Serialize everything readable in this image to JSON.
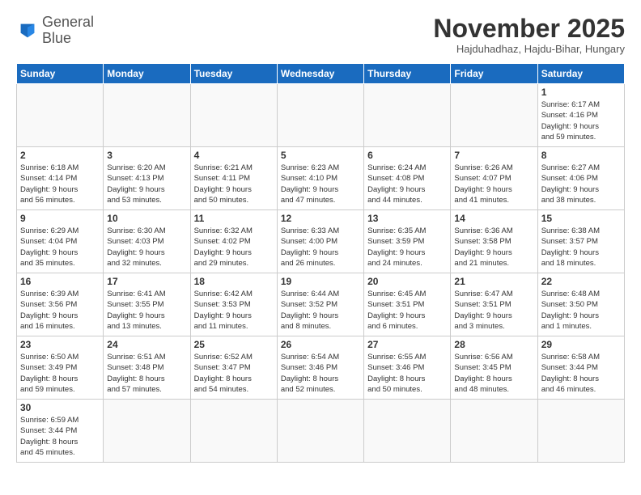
{
  "header": {
    "logo_line1": "General",
    "logo_line2": "Blue",
    "month": "November 2025",
    "location": "Hajduhadhaz, Hajdu-Bihar, Hungary"
  },
  "weekdays": [
    "Sunday",
    "Monday",
    "Tuesday",
    "Wednesday",
    "Thursday",
    "Friday",
    "Saturday"
  ],
  "days": {
    "1": {
      "sunrise": "6:17 AM",
      "sunset": "4:16 PM",
      "daylight_h": "9",
      "daylight_m": "59"
    },
    "2": {
      "sunrise": "6:18 AM",
      "sunset": "4:14 PM",
      "daylight_h": "9",
      "daylight_m": "56"
    },
    "3": {
      "sunrise": "6:20 AM",
      "sunset": "4:13 PM",
      "daylight_h": "9",
      "daylight_m": "53"
    },
    "4": {
      "sunrise": "6:21 AM",
      "sunset": "4:11 PM",
      "daylight_h": "9",
      "daylight_m": "50"
    },
    "5": {
      "sunrise": "6:23 AM",
      "sunset": "4:10 PM",
      "daylight_h": "9",
      "daylight_m": "47"
    },
    "6": {
      "sunrise": "6:24 AM",
      "sunset": "4:08 PM",
      "daylight_h": "9",
      "daylight_m": "44"
    },
    "7": {
      "sunrise": "6:26 AM",
      "sunset": "4:07 PM",
      "daylight_h": "9",
      "daylight_m": "41"
    },
    "8": {
      "sunrise": "6:27 AM",
      "sunset": "4:06 PM",
      "daylight_h": "9",
      "daylight_m": "38"
    },
    "9": {
      "sunrise": "6:29 AM",
      "sunset": "4:04 PM",
      "daylight_h": "9",
      "daylight_m": "35"
    },
    "10": {
      "sunrise": "6:30 AM",
      "sunset": "4:03 PM",
      "daylight_h": "9",
      "daylight_m": "32"
    },
    "11": {
      "sunrise": "6:32 AM",
      "sunset": "4:02 PM",
      "daylight_h": "9",
      "daylight_m": "29"
    },
    "12": {
      "sunrise": "6:33 AM",
      "sunset": "4:00 PM",
      "daylight_h": "9",
      "daylight_m": "26"
    },
    "13": {
      "sunrise": "6:35 AM",
      "sunset": "3:59 PM",
      "daylight_h": "9",
      "daylight_m": "24"
    },
    "14": {
      "sunrise": "6:36 AM",
      "sunset": "3:58 PM",
      "daylight_h": "9",
      "daylight_m": "21"
    },
    "15": {
      "sunrise": "6:38 AM",
      "sunset": "3:57 PM",
      "daylight_h": "9",
      "daylight_m": "18"
    },
    "16": {
      "sunrise": "6:39 AM",
      "sunset": "3:56 PM",
      "daylight_h": "9",
      "daylight_m": "16"
    },
    "17": {
      "sunrise": "6:41 AM",
      "sunset": "3:55 PM",
      "daylight_h": "9",
      "daylight_m": "13"
    },
    "18": {
      "sunrise": "6:42 AM",
      "sunset": "3:53 PM",
      "daylight_h": "9",
      "daylight_m": "11"
    },
    "19": {
      "sunrise": "6:44 AM",
      "sunset": "3:52 PM",
      "daylight_h": "9",
      "daylight_m": "8"
    },
    "20": {
      "sunrise": "6:45 AM",
      "sunset": "3:51 PM",
      "daylight_h": "9",
      "daylight_m": "6"
    },
    "21": {
      "sunrise": "6:47 AM",
      "sunset": "3:51 PM",
      "daylight_h": "9",
      "daylight_m": "3"
    },
    "22": {
      "sunrise": "6:48 AM",
      "sunset": "3:50 PM",
      "daylight_h": "9",
      "daylight_m": "1"
    },
    "23": {
      "sunrise": "6:50 AM",
      "sunset": "3:49 PM",
      "daylight_h": "8",
      "daylight_m": "59"
    },
    "24": {
      "sunrise": "6:51 AM",
      "sunset": "3:48 PM",
      "daylight_h": "8",
      "daylight_m": "57"
    },
    "25": {
      "sunrise": "6:52 AM",
      "sunset": "3:47 PM",
      "daylight_h": "8",
      "daylight_m": "54"
    },
    "26": {
      "sunrise": "6:54 AM",
      "sunset": "3:46 PM",
      "daylight_h": "8",
      "daylight_m": "52"
    },
    "27": {
      "sunrise": "6:55 AM",
      "sunset": "3:46 PM",
      "daylight_h": "8",
      "daylight_m": "50"
    },
    "28": {
      "sunrise": "6:56 AM",
      "sunset": "3:45 PM",
      "daylight_h": "8",
      "daylight_m": "48"
    },
    "29": {
      "sunrise": "6:58 AM",
      "sunset": "3:44 PM",
      "daylight_h": "8",
      "daylight_m": "46"
    },
    "30": {
      "sunrise": "6:59 AM",
      "sunset": "3:44 PM",
      "daylight_h": "8",
      "daylight_m": "45"
    }
  }
}
